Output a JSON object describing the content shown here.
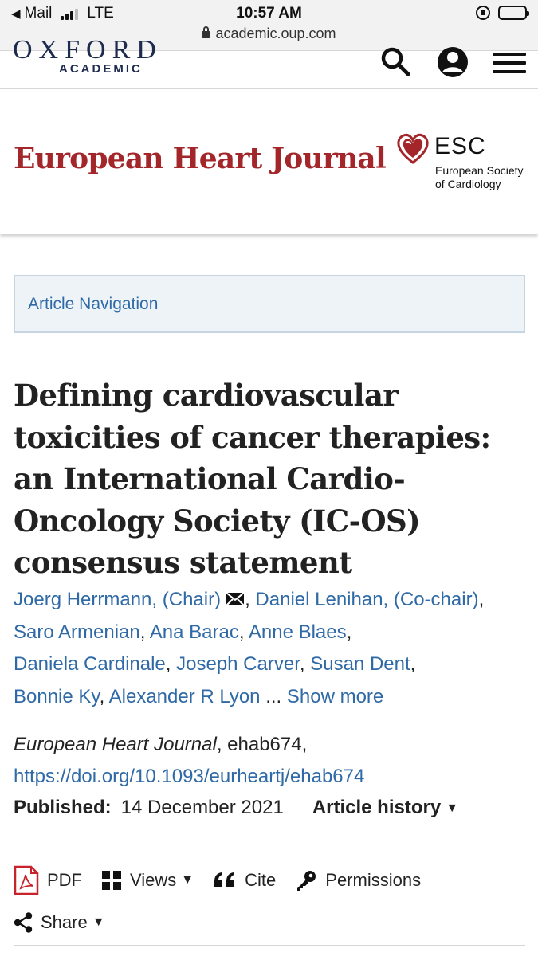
{
  "status_bar": {
    "back_label": "Mail",
    "network": "LTE",
    "time": "10:57 AM",
    "battery_level": 0.6,
    "url": "academic.oup.com"
  },
  "header": {
    "brand_top": "OXFORD",
    "brand_bottom": "ACADEMIC",
    "icons": [
      "search-icon",
      "user-icon",
      "menu-icon"
    ]
  },
  "journal": {
    "title": "European Heart Journal",
    "society_abbr": "ESC",
    "society_name_line1": "European Society",
    "society_name_line2": "of Cardiology",
    "brand_color": "#a3262b"
  },
  "article_nav": {
    "label": "Article Navigation"
  },
  "article": {
    "title": "Defining cardiovascular toxicities of cancer therapies: an International Cardio-Oncology Society (IC-OS) consensus statement",
    "authors": [
      "Joerg Herrmann, (Chair)",
      "Daniel Lenihan, (Co-chair)",
      "Saro Armenian",
      "Ana Barac",
      "Anne Blaes",
      "Daniela Cardinale",
      "Joseph Carver",
      "Susan Dent",
      "Bonnie Ky",
      "Alexander R Lyon"
    ],
    "ellipsis": "...",
    "show_more": "Show more",
    "journal_name": "European Heart Journal",
    "article_id": ", ehab674,",
    "doi": "https://doi.org/10.1093/eurheartj/ehab674",
    "published_label": "Published:",
    "published_date": "14 December 2021",
    "history_label": "Article history",
    "link_color": "#2f6aa6"
  },
  "toolbar": {
    "pdf": "PDF",
    "views": "Views",
    "cite": "Cite",
    "permissions": "Permissions",
    "share": "Share"
  }
}
